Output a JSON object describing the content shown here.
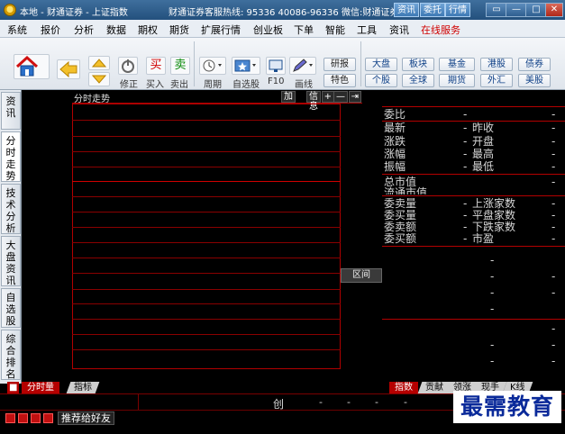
{
  "window": {
    "title": "本地 - 财通证券 - 上证指数",
    "hotline": "财通证券客服热线: 95336  40086-96336  微信:财通证券",
    "title_buttons": [
      "资讯",
      "委托",
      "行情"
    ],
    "controls": [
      "▭",
      "—",
      "□",
      "✕"
    ]
  },
  "menu": {
    "items": [
      "系统",
      "报价",
      "分析",
      "数据",
      "期权",
      "期货",
      "扩展行情",
      "创业板",
      "下单",
      "智能",
      "工具",
      "资讯",
      "在线服务"
    ]
  },
  "toolbar": {
    "labels": {
      "restore": "修正",
      "buy": "买入",
      "sell": "卖出",
      "period": "周期",
      "watchlist": "自选股",
      "f10": "F10",
      "draw": "画线"
    },
    "buy_char": "买",
    "sell_char": "卖",
    "research": "研报",
    "special": "特色",
    "market_buttons": [
      [
        "大盘",
        "板块",
        "基金",
        "港股",
        "债券"
      ],
      [
        "个股",
        "全球",
        "期货",
        "外汇",
        "美股"
      ]
    ]
  },
  "left_tabs": [
    "资讯",
    "分时走势",
    "技术分析",
    "大盘资讯",
    "自选股",
    "综合排名"
  ],
  "chart": {
    "title": "分时走势",
    "tools": [
      "加",
      "信息",
      "+",
      "—",
      "⇥"
    ],
    "region_button": "区间"
  },
  "right_panel": {
    "rows_a": [
      {
        "label": "委比",
        "value": "-"
      },
      {
        "label": "最新",
        "value": "-",
        "label2": "昨收"
      },
      {
        "label": "涨跌",
        "value": "-",
        "label2": "开盘"
      },
      {
        "label": "涨幅",
        "value": "-",
        "label2": "最高"
      },
      {
        "label": "振幅",
        "value": "-",
        "label2": "最低"
      }
    ],
    "rows_b": [
      {
        "label": "总市值"
      },
      {
        "label": "流通市值"
      }
    ],
    "rows_c": [
      {
        "label": "委卖量",
        "value": "-",
        "label2": "上涨家数"
      },
      {
        "label": "委买量",
        "value": "-",
        "label2": "平盘家数"
      },
      {
        "label": "委卖额",
        "value": "-",
        "label2": "下跌家数"
      },
      {
        "label": "委买额",
        "value": "-",
        "label2": "市盈"
      }
    ],
    "dash": "-",
    "tabs": [
      "指数",
      "贡献",
      "领涨",
      "现手",
      "K线"
    ]
  },
  "bottom": {
    "tabs": [
      "分时量",
      "指标"
    ],
    "status_text": "创",
    "dash": "-",
    "recommend": "推荐给好友"
  },
  "watermark": "最需教育"
}
